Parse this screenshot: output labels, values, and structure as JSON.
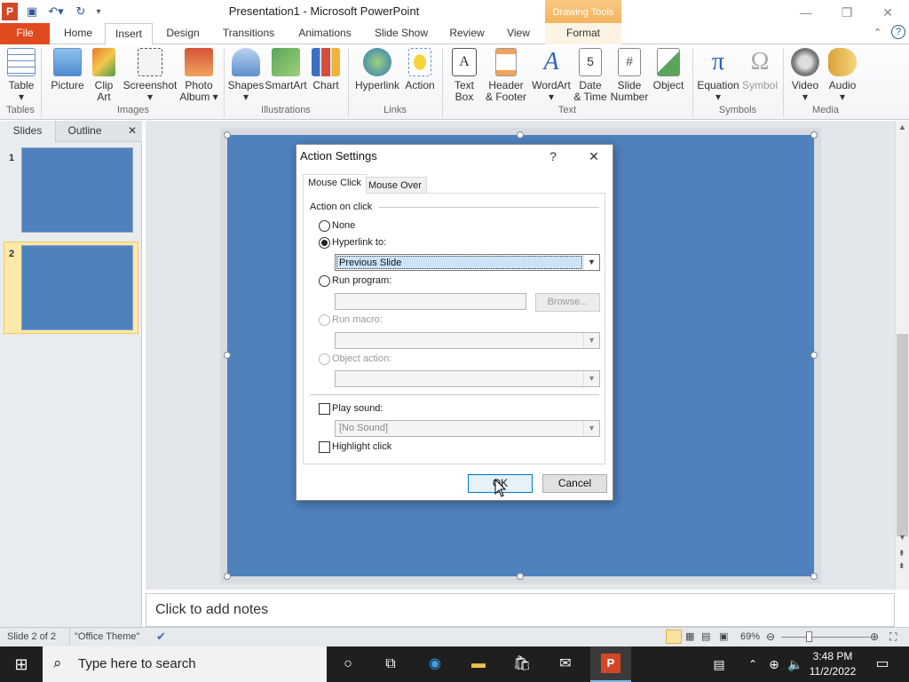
{
  "window": {
    "title": "Presentation1  -  Microsoft PowerPoint",
    "contextual_tab_group": "Drawing Tools",
    "app_icon_letter": "P"
  },
  "tabs": [
    "File",
    "Home",
    "Insert",
    "Design",
    "Transitions",
    "Animations",
    "Slide Show",
    "Review",
    "View",
    "Format"
  ],
  "active_tab": "Insert",
  "ribbon": {
    "buttons": [
      {
        "label": "Table",
        "icon": "table-icon"
      },
      {
        "label": "Picture",
        "icon": "picture-icon"
      },
      {
        "label": "Clip\nArt",
        "icon": "clip-art-icon"
      },
      {
        "label": "Screenshot",
        "icon": "screenshot-icon"
      },
      {
        "label": "Photo\nAlbum",
        "icon": "photo-album-icon"
      },
      {
        "label": "Shapes",
        "icon": "shapes-icon"
      },
      {
        "label": "SmartArt",
        "icon": "smartart-icon"
      },
      {
        "label": "Chart",
        "icon": "chart-icon"
      },
      {
        "label": "Hyperlink",
        "icon": "hyperlink-icon"
      },
      {
        "label": "Action",
        "icon": "action-icon"
      },
      {
        "label": "Text\nBox",
        "icon": "text-box-icon"
      },
      {
        "label": "Header\n& Footer",
        "icon": "header-footer-icon"
      },
      {
        "label": "WordArt",
        "icon": "wordart-icon"
      },
      {
        "label": "Date\n& Time",
        "icon": "date-time-icon"
      },
      {
        "label": "Slide\nNumber",
        "icon": "slide-number-icon"
      },
      {
        "label": "Object",
        "icon": "object-icon"
      },
      {
        "label": "Equation",
        "icon": "equation-icon"
      },
      {
        "label": "Symbol",
        "icon": "symbol-icon"
      },
      {
        "label": "Video",
        "icon": "video-icon"
      },
      {
        "label": "Audio",
        "icon": "audio-icon"
      }
    ],
    "groups": [
      "Tables",
      "Images",
      "Illustrations",
      "Links",
      "Text",
      "Symbols",
      "Media"
    ]
  },
  "left_panel": {
    "tabs": [
      "Slides",
      "Outline"
    ],
    "close_glyph": "✕",
    "slide_numbers": [
      "1",
      "2"
    ]
  },
  "notes_placeholder": "Click to add notes",
  "status": {
    "slide_info": "Slide 2 of 2",
    "theme": "\"Office Theme\"",
    "zoom": "69%"
  },
  "taskbar": {
    "search_placeholder": "Type here to search",
    "time": "3:48 PM",
    "date": "11/2/2022"
  },
  "dialog": {
    "title": "Action Settings",
    "help_glyph": "?",
    "close_glyph": "✕",
    "tabs": [
      "Mouse Click",
      "Mouse Over"
    ],
    "section_label": "Action on click",
    "options": {
      "none": "None",
      "hyperlink": "Hyperlink to:",
      "run_program": "Run program:",
      "run_macro": "Run macro:",
      "object_action": "Object action:"
    },
    "hyperlink_value": "Previous Slide",
    "browse_label": "Browse...",
    "play_sound_label": "Play sound:",
    "sound_value": "[No Sound]",
    "highlight_click_label": "Highlight click",
    "ok_label": "OK",
    "cancel_label": "Cancel"
  },
  "colors": {
    "slide_fill": "#4f81bd",
    "file_tab": "#e04a1f",
    "drawing_tools": "#f3b15a",
    "selection_highlight": "#cce4f7"
  }
}
